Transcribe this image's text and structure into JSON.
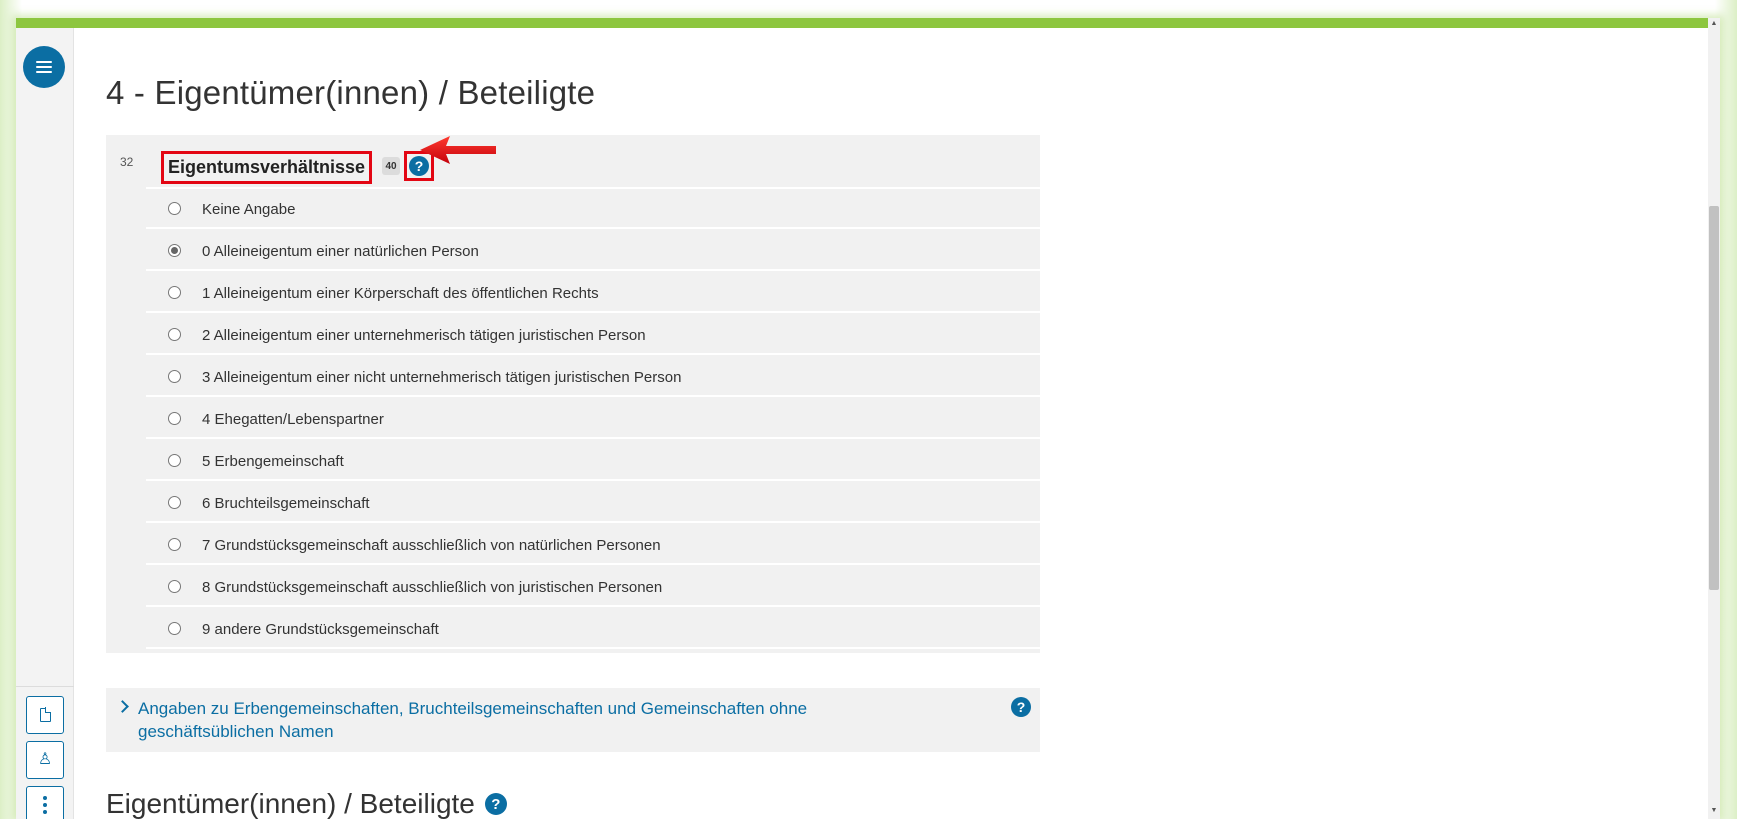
{
  "colors": {
    "accent": "#8dc63f",
    "primary": "#0b6ea3",
    "highlight": "#e30613"
  },
  "section": {
    "title": "4 - Eigentümer(innen) / Beteiligte"
  },
  "field": {
    "number": "32",
    "label": "Eigentumsverhältnisse",
    "badge": "40",
    "help_icon": "?",
    "options": [
      {
        "label": "Keine Angabe",
        "checked": false
      },
      {
        "label": "0 Alleineigentum einer natürlichen Person",
        "checked": true
      },
      {
        "label": "1 Alleineigentum einer Körperschaft des öffentlichen Rechts",
        "checked": false
      },
      {
        "label": "2 Alleineigentum einer unternehmerisch tätigen juristischen Person",
        "checked": false
      },
      {
        "label": "3 Alleineigentum einer nicht unternehmerisch tätigen juristischen Person",
        "checked": false
      },
      {
        "label": "4 Ehegatten/Lebenspartner",
        "checked": false
      },
      {
        "label": "5 Erbengemeinschaft",
        "checked": false
      },
      {
        "label": "6 Bruchteilsgemeinschaft",
        "checked": false
      },
      {
        "label": "7 Grundstücksgemeinschaft ausschließlich von natürlichen Personen",
        "checked": false
      },
      {
        "label": "8 Grundstücksgemeinschaft ausschließlich von juristischen Personen",
        "checked": false
      },
      {
        "label": "9 andere Grundstücksgemeinschaft",
        "checked": false
      }
    ]
  },
  "expander": {
    "text": "Angaben zu Erbengemeinschaften, Bruchteilsgemeinschaften und Gemeinschaften ohne geschäftsüblichen Namen",
    "help_icon": "?"
  },
  "subsection": {
    "title": "Eigentümer(innen) / Beteiligte",
    "help_icon": "?"
  },
  "rail": {
    "icons": [
      "menu-icon",
      "document-icon",
      "person-icon",
      "more-vertical-icon"
    ]
  },
  "annotation": {
    "arrow_icon": "red-arrow-left-icon"
  }
}
